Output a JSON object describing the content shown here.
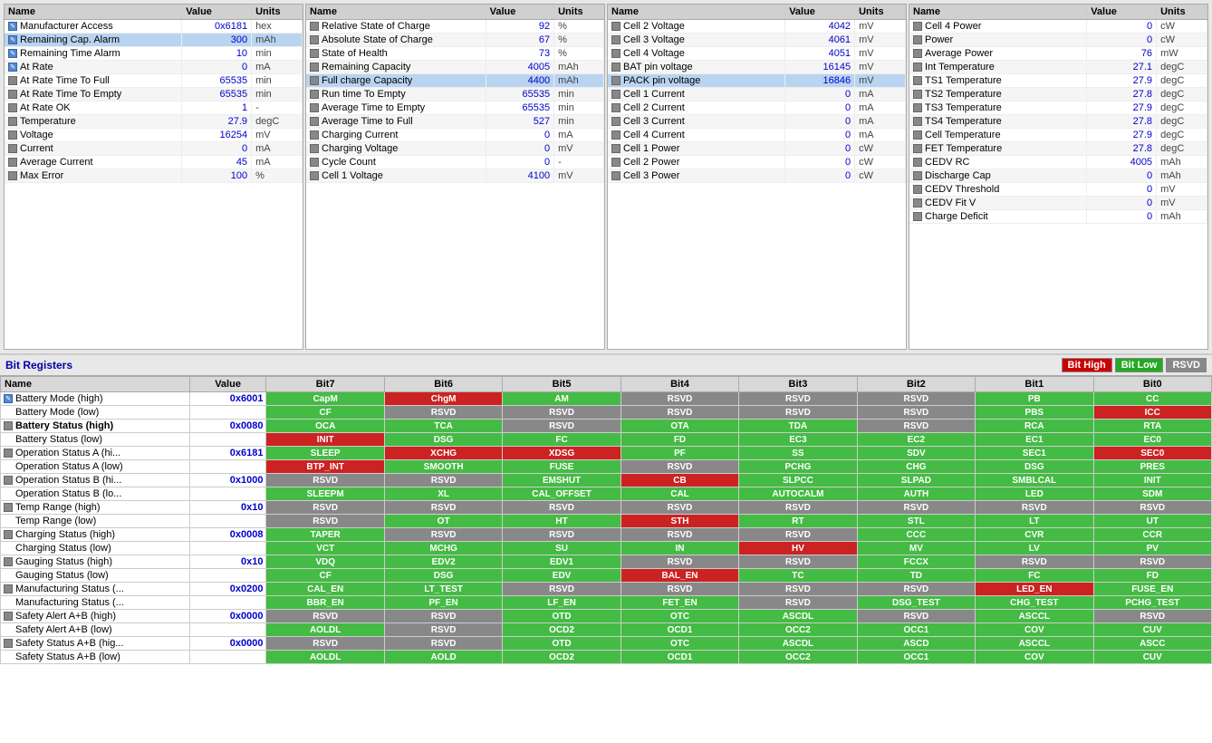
{
  "panels": [
    {
      "id": "panel1",
      "columns": [
        "Name",
        "Value",
        "Units"
      ],
      "rows": [
        {
          "icon": "edit",
          "name": "Manufacturer Access",
          "value": "0x6181",
          "units": "hex",
          "highlight": false
        },
        {
          "icon": "edit",
          "name": "Remaining Cap. Alarm",
          "value": "300",
          "units": "mAh",
          "highlight": true
        },
        {
          "icon": "edit",
          "name": "Remaining Time Alarm",
          "value": "10",
          "units": "min",
          "highlight": false
        },
        {
          "icon": "edit",
          "name": "At Rate",
          "value": "0",
          "units": "mA",
          "highlight": false
        },
        {
          "icon": "lock",
          "name": "At Rate Time To Full",
          "value": "65535",
          "units": "min",
          "highlight": false
        },
        {
          "icon": "lock",
          "name": "At Rate Time To Empty",
          "value": "65535",
          "units": "min",
          "highlight": false
        },
        {
          "icon": "lock",
          "name": "At Rate OK",
          "value": "1",
          "units": "-",
          "highlight": false
        },
        {
          "icon": "lock",
          "name": "Temperature",
          "value": "27.9",
          "units": "degC",
          "highlight": false
        },
        {
          "icon": "lock",
          "name": "Voltage",
          "value": "16254",
          "units": "mV",
          "highlight": false
        },
        {
          "icon": "lock",
          "name": "Current",
          "value": "0",
          "units": "mA",
          "highlight": false
        },
        {
          "icon": "lock",
          "name": "Average Current",
          "value": "45",
          "units": "mA",
          "highlight": false
        },
        {
          "icon": "lock",
          "name": "Max Error",
          "value": "100",
          "units": "%",
          "highlight": false
        }
      ]
    },
    {
      "id": "panel2",
      "columns": [
        "Name",
        "Value",
        "Units"
      ],
      "rows": [
        {
          "icon": "lock",
          "name": "Relative State of Charge",
          "value": "92",
          "units": "%",
          "highlight": false
        },
        {
          "icon": "lock",
          "name": "Absolute State of Charge",
          "value": "67",
          "units": "%",
          "highlight": false
        },
        {
          "icon": "lock",
          "name": "State of Health",
          "value": "73",
          "units": "%",
          "highlight": false
        },
        {
          "icon": "lock",
          "name": "Remaining Capacity",
          "value": "4005",
          "units": "mAh",
          "highlight": false
        },
        {
          "icon": "lock",
          "name": "Full charge Capacity",
          "value": "4400",
          "units": "mAh",
          "highlight": true
        },
        {
          "icon": "lock",
          "name": "Run time To Empty",
          "value": "65535",
          "units": "min",
          "highlight": false
        },
        {
          "icon": "lock",
          "name": "Average Time to Empty",
          "value": "65535",
          "units": "min",
          "highlight": false
        },
        {
          "icon": "lock",
          "name": "Average Time to Full",
          "value": "527",
          "units": "min",
          "highlight": false
        },
        {
          "icon": "lock",
          "name": "Charging Current",
          "value": "0",
          "units": "mA",
          "highlight": false
        },
        {
          "icon": "lock",
          "name": "Charging Voltage",
          "value": "0",
          "units": "mV",
          "highlight": false
        },
        {
          "icon": "lock",
          "name": "Cycle Count",
          "value": "0",
          "units": "-",
          "highlight": false
        },
        {
          "icon": "lock",
          "name": "Cell 1 Voltage",
          "value": "4100",
          "units": "mV",
          "highlight": false
        }
      ]
    },
    {
      "id": "panel3",
      "columns": [
        "Name",
        "Value",
        "Units"
      ],
      "rows": [
        {
          "icon": "lock",
          "name": "Cell 2 Voltage",
          "value": "4042",
          "units": "mV",
          "highlight": false
        },
        {
          "icon": "lock",
          "name": "Cell 3 Voltage",
          "value": "4061",
          "units": "mV",
          "highlight": false
        },
        {
          "icon": "lock",
          "name": "Cell 4 Voltage",
          "value": "4051",
          "units": "mV",
          "highlight": false
        },
        {
          "icon": "lock",
          "name": "BAT pin voltage",
          "value": "16145",
          "units": "mV",
          "highlight": false
        },
        {
          "icon": "lock",
          "name": "PACK pin voltage",
          "value": "16846",
          "units": "mV",
          "highlight": true
        },
        {
          "icon": "lock",
          "name": "Cell 1 Current",
          "value": "0",
          "units": "mA",
          "highlight": false
        },
        {
          "icon": "lock",
          "name": "Cell 2 Current",
          "value": "0",
          "units": "mA",
          "highlight": false
        },
        {
          "icon": "lock",
          "name": "Cell 3 Current",
          "value": "0",
          "units": "mA",
          "highlight": false
        },
        {
          "icon": "lock",
          "name": "Cell 4 Current",
          "value": "0",
          "units": "mA",
          "highlight": false
        },
        {
          "icon": "lock",
          "name": "Cell 1 Power",
          "value": "0",
          "units": "cW",
          "highlight": false
        },
        {
          "icon": "lock",
          "name": "Cell 2 Power",
          "value": "0",
          "units": "cW",
          "highlight": false
        },
        {
          "icon": "lock",
          "name": "Cell 3 Power",
          "value": "0",
          "units": "cW",
          "highlight": false
        }
      ]
    },
    {
      "id": "panel4",
      "columns": [
        "Name",
        "Value",
        "Units"
      ],
      "rows": [
        {
          "icon": "lock",
          "name": "Cell 4 Power",
          "value": "0",
          "units": "cW",
          "highlight": false
        },
        {
          "icon": "lock",
          "name": "Power",
          "value": "0",
          "units": "cW",
          "highlight": false
        },
        {
          "icon": "lock",
          "name": "Average Power",
          "value": "76",
          "units": "mW",
          "highlight": false
        },
        {
          "icon": "lock",
          "name": "Int Temperature",
          "value": "27.1",
          "units": "degC",
          "highlight": false
        },
        {
          "icon": "lock",
          "name": "TS1 Temperature",
          "value": "27.9",
          "units": "degC",
          "highlight": false
        },
        {
          "icon": "lock",
          "name": "TS2 Temperature",
          "value": "27.8",
          "units": "degC",
          "highlight": false
        },
        {
          "icon": "lock",
          "name": "TS3 Temperature",
          "value": "27.9",
          "units": "degC",
          "highlight": false
        },
        {
          "icon": "lock",
          "name": "TS4 Temperature",
          "value": "27.8",
          "units": "degC",
          "highlight": false
        },
        {
          "icon": "lock",
          "name": "Cell Temperature",
          "value": "27.9",
          "units": "degC",
          "highlight": false
        },
        {
          "icon": "lock",
          "name": "FET Temperature",
          "value": "27.8",
          "units": "degC",
          "highlight": false
        },
        {
          "icon": "lock",
          "name": "CEDV RC",
          "value": "4005",
          "units": "mAh",
          "highlight": false
        },
        {
          "icon": "lock",
          "name": "Discharge Cap",
          "value": "0",
          "units": "mAh",
          "highlight": false
        },
        {
          "icon": "lock",
          "name": "CEDV Threshold",
          "value": "0",
          "units": "mV",
          "highlight": false
        },
        {
          "icon": "lock",
          "name": "CEDV Fit V",
          "value": "0",
          "units": "mV",
          "highlight": false
        },
        {
          "icon": "lock",
          "name": "Charge Deficit",
          "value": "0",
          "units": "mAh",
          "highlight": false
        }
      ]
    }
  ],
  "bitRegisters": {
    "title": "Bit Registers",
    "legend": {
      "high": "Bit High",
      "low": "Bit Low",
      "rsvd": "RSVD"
    },
    "columns": [
      "Name",
      "Value",
      "Bit7",
      "Bit6",
      "Bit5",
      "Bit4",
      "Bit3",
      "Bit2",
      "Bit1",
      "Bit0"
    ],
    "rows": [
      {
        "name": "Battery Mode (high)",
        "bold": false,
        "icon": "edit",
        "value": "0x6001",
        "bits": [
          "CapM",
          "ChgM",
          "AM",
          "RSVD",
          "RSVD",
          "RSVD",
          "PB",
          "CC"
        ],
        "colors": [
          "green",
          "red",
          "green",
          "gray",
          "gray",
          "gray",
          "green",
          "green"
        ]
      },
      {
        "name": "Battery Mode (low)",
        "bold": false,
        "icon": null,
        "value": "",
        "bits": [
          "CF",
          "RSVD",
          "RSVD",
          "RSVD",
          "RSVD",
          "RSVD",
          "PBS",
          "ICC"
        ],
        "colors": [
          "green",
          "gray",
          "gray",
          "gray",
          "gray",
          "gray",
          "green",
          "red"
        ]
      },
      {
        "name": "Battery Status (high)",
        "bold": true,
        "icon": "lock",
        "value": "0x0080",
        "bits": [
          "OCA",
          "TCA",
          "RSVD",
          "OTA",
          "TDA",
          "RSVD",
          "RCA",
          "RTA"
        ],
        "colors": [
          "green",
          "green",
          "gray",
          "green",
          "green",
          "gray",
          "green",
          "green"
        ]
      },
      {
        "name": "Battery Status (low)",
        "bold": false,
        "icon": null,
        "value": "",
        "bits": [
          "INIT",
          "DSG",
          "FC",
          "FD",
          "EC3",
          "EC2",
          "EC1",
          "EC0"
        ],
        "colors": [
          "red",
          "green",
          "green",
          "green",
          "green",
          "green",
          "green",
          "green"
        ]
      },
      {
        "name": "Operation Status A (hi...",
        "bold": false,
        "icon": "lock",
        "value": "0x6181",
        "bits": [
          "SLEEP",
          "XCHG",
          "XDSG",
          "PF",
          "SS",
          "SDV",
          "SEC1",
          "SEC0"
        ],
        "colors": [
          "green",
          "red",
          "red",
          "green",
          "green",
          "green",
          "green",
          "red"
        ]
      },
      {
        "name": "Operation Status A (low)",
        "bold": false,
        "icon": null,
        "value": "",
        "bits": [
          "BTP_INT",
          "SMOOTH",
          "FUSE",
          "RSVD",
          "PCHG",
          "CHG",
          "DSG",
          "PRES"
        ],
        "colors": [
          "red",
          "green",
          "green",
          "gray",
          "green",
          "green",
          "green",
          "green"
        ]
      },
      {
        "name": "Operation Status B (hi...",
        "bold": false,
        "icon": "lock",
        "value": "0x1000",
        "bits": [
          "RSVD",
          "RSVD",
          "EMSHUT",
          "CB",
          "SLPCC",
          "SLPAD",
          "SMBLCAL",
          "INIT"
        ],
        "colors": [
          "gray",
          "gray",
          "green",
          "red",
          "green",
          "green",
          "green",
          "green"
        ]
      },
      {
        "name": "Operation Status B (lo...",
        "bold": false,
        "icon": null,
        "value": "",
        "bits": [
          "SLEEPM",
          "XL",
          "CAL_OFFSET",
          "CAL",
          "AUTOCALM",
          "AUTH",
          "LED",
          "SDM"
        ],
        "colors": [
          "green",
          "green",
          "green",
          "green",
          "green",
          "green",
          "green",
          "green"
        ]
      },
      {
        "name": "Temp Range (high)",
        "bold": false,
        "icon": "lock",
        "value": "0x10",
        "bits": [
          "RSVD",
          "RSVD",
          "RSVD",
          "RSVD",
          "RSVD",
          "RSVD",
          "RSVD",
          "RSVD"
        ],
        "colors": [
          "gray",
          "gray",
          "gray",
          "gray",
          "gray",
          "gray",
          "gray",
          "gray"
        ]
      },
      {
        "name": "Temp Range (low)",
        "bold": false,
        "icon": null,
        "value": "",
        "bits": [
          "RSVD",
          "OT",
          "HT",
          "STH",
          "RT",
          "STL",
          "LT",
          "UT"
        ],
        "colors": [
          "gray",
          "green",
          "green",
          "red",
          "green",
          "green",
          "green",
          "green"
        ]
      },
      {
        "name": "Charging Status (high)",
        "bold": false,
        "icon": "lock",
        "value": "0x0008",
        "bits": [
          "TAPER",
          "RSVD",
          "RSVD",
          "RSVD",
          "RSVD",
          "CCC",
          "CVR",
          "CCR"
        ],
        "colors": [
          "green",
          "gray",
          "gray",
          "gray",
          "gray",
          "green",
          "green",
          "green"
        ]
      },
      {
        "name": "Charging Status (low)",
        "bold": false,
        "icon": null,
        "value": "",
        "bits": [
          "VCT",
          "MCHG",
          "SU",
          "IN",
          "HV",
          "MV",
          "LV",
          "PV"
        ],
        "colors": [
          "green",
          "green",
          "green",
          "green",
          "red",
          "green",
          "green",
          "green"
        ]
      },
      {
        "name": "Gauging Status (high)",
        "bold": false,
        "icon": "lock",
        "value": "0x10",
        "bits": [
          "VDQ",
          "EDV2",
          "EDV1",
          "RSVD",
          "RSVD",
          "FCCX",
          "RSVD",
          "RSVD"
        ],
        "colors": [
          "green",
          "green",
          "green",
          "gray",
          "gray",
          "green",
          "gray",
          "gray"
        ]
      },
      {
        "name": "Gauging Status (low)",
        "bold": false,
        "icon": null,
        "value": "",
        "bits": [
          "CF",
          "DSG",
          "EDV",
          "BAL_EN",
          "TC",
          "TD",
          "FC",
          "FD"
        ],
        "colors": [
          "green",
          "green",
          "green",
          "red",
          "green",
          "green",
          "green",
          "green"
        ]
      },
      {
        "name": "Manufacturing Status (...",
        "bold": false,
        "icon": "lock",
        "value": "0x0200",
        "bits": [
          "CAL_EN",
          "LT_TEST",
          "RSVD",
          "RSVD",
          "RSVD",
          "RSVD",
          "LED_EN",
          "FUSE_EN"
        ],
        "colors": [
          "green",
          "green",
          "gray",
          "gray",
          "gray",
          "gray",
          "red",
          "green"
        ]
      },
      {
        "name": "Manufacturing Status (...",
        "bold": false,
        "icon": null,
        "value": "",
        "bits": [
          "BBR_EN",
          "PF_EN",
          "LF_EN",
          "FET_EN",
          "RSVD",
          "DSG_TEST",
          "CHG_TEST",
          "PCHG_TEST"
        ],
        "colors": [
          "green",
          "green",
          "green",
          "green",
          "gray",
          "green",
          "green",
          "green"
        ]
      },
      {
        "name": "Safety Alert A+B (high)",
        "bold": false,
        "icon": "lock",
        "value": "0x0000",
        "bits": [
          "RSVD",
          "RSVD",
          "OTD",
          "OTC",
          "ASCDL",
          "RSVD",
          "ASCCL",
          "RSVD"
        ],
        "colors": [
          "gray",
          "gray",
          "green",
          "green",
          "green",
          "gray",
          "green",
          "gray"
        ]
      },
      {
        "name": "Safety Alert A+B (low)",
        "bold": false,
        "icon": null,
        "value": "",
        "bits": [
          "AOLDL",
          "RSVD",
          "OCD2",
          "OCD1",
          "OCC2",
          "OCC1",
          "COV",
          "CUV"
        ],
        "colors": [
          "green",
          "gray",
          "green",
          "green",
          "green",
          "green",
          "green",
          "green"
        ]
      },
      {
        "name": "Safety Status A+B (hig...",
        "bold": false,
        "icon": "lock",
        "value": "0x0000",
        "bits": [
          "RSVD",
          "RSVD",
          "OTD",
          "OTC",
          "ASCDL",
          "ASCD",
          "ASCCL",
          "ASCC"
        ],
        "colors": [
          "gray",
          "gray",
          "green",
          "green",
          "green",
          "green",
          "green",
          "green"
        ]
      },
      {
        "name": "Safety Status A+B (low)",
        "bold": false,
        "icon": null,
        "value": "",
        "bits": [
          "AOLDL",
          "AOLD",
          "OCD2",
          "OCD1",
          "OCC2",
          "OCC1",
          "COV",
          "CUV"
        ],
        "colors": [
          "green",
          "green",
          "green",
          "green",
          "green",
          "green",
          "green",
          "green"
        ]
      }
    ]
  }
}
